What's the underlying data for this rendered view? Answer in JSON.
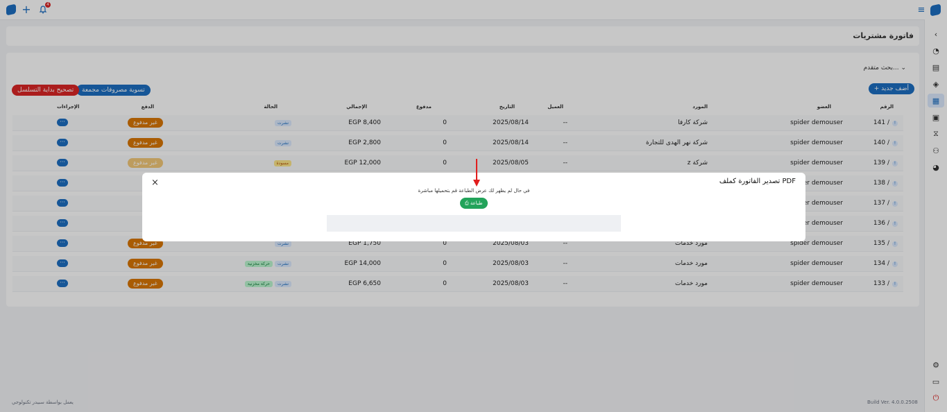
{
  "topbar": {
    "notification_count": "4"
  },
  "page": {
    "title": "فاتورة مشتريات"
  },
  "toolbar": {
    "advanced_search": "بحث متقدم...",
    "add_new": "+ أضف جديد",
    "settle_expenses": "تسوية مصروفات مجمعة",
    "fix_sequence": "تصحيح بداية التسلسل"
  },
  "table": {
    "headers": [
      "الرقم",
      "العضو",
      "المورد",
      "العميل",
      "التاريخ",
      "مدفوع",
      "الإجمالي",
      "الحالة",
      "الدفع",
      "الإجراءات"
    ],
    "rows": [
      {
        "number": "141 /",
        "member": "spider demouser",
        "supplier": "شركة كارفا",
        "client": "--",
        "date": "2025/08/14",
        "paid": "0",
        "total": "EGP 8,400",
        "status": "نشرت",
        "status2": "",
        "payment": "غير مدفوع",
        "action": "···"
      },
      {
        "number": "140 /",
        "member": "spider demouser",
        "supplier": "شركة  نهر الهدى للتجارة",
        "client": "--",
        "date": "2025/08/14",
        "paid": "0",
        "total": "EGP 2,800",
        "status": "نشرت",
        "status2": "",
        "payment": "غير مدفوع",
        "action": "···"
      },
      {
        "number": "139 /",
        "member": "spider demouser",
        "supplier": "شركة z",
        "client": "--",
        "date": "2025/08/05",
        "paid": "0",
        "total": "EGP 12,000",
        "status": "مسودة",
        "status2": "",
        "payment": "غير مدفوع",
        "action": "···"
      },
      {
        "number": "138 /",
        "member": "spider demouser",
        "supplier": "",
        "client": "",
        "date": "",
        "paid": "",
        "total": "",
        "status": "",
        "status2": "",
        "payment": "",
        "action": "···"
      },
      {
        "number": "137 /",
        "member": "spider demouser",
        "supplier": "",
        "client": "",
        "date": "",
        "paid": "",
        "total": "",
        "status": "",
        "status2": "",
        "payment": "",
        "action": "···"
      },
      {
        "number": "136 /",
        "member": "spider demouser",
        "supplier": "",
        "client": "",
        "date": "",
        "paid": "",
        "total": "",
        "status": "",
        "status2": "",
        "payment": "",
        "action": "···"
      },
      {
        "number": "135 /",
        "member": "spider demouser",
        "supplier": "مورد خدمات",
        "client": "--",
        "date": "2025/08/03",
        "paid": "0",
        "total": "EGP 1,750",
        "status": "نشرت",
        "status2": "",
        "payment": "غير مدفوع",
        "action": "···"
      },
      {
        "number": "134 /",
        "member": "spider demouser",
        "supplier": "مورد خدمات",
        "client": "--",
        "date": "2025/08/03",
        "paid": "0",
        "total": "EGP 14,000",
        "status": "نشرت",
        "status2": "حركة مخزنية",
        "payment": "غير مدفوع",
        "action": "···"
      },
      {
        "number": "133 /",
        "member": "spider demouser",
        "supplier": "مورد خدمات",
        "client": "--",
        "date": "2025/08/03",
        "paid": "0",
        "total": "EGP 6,650",
        "status": "نشرت",
        "status2": "حركة مخزنية",
        "payment": "غير مدفوع",
        "action": "···"
      }
    ]
  },
  "footer": {
    "credit": "يعمل بواسطة سبيدر تكنولوجي",
    "build": "Build Ver. 4.0.0.2508"
  },
  "modal": {
    "title": "تصدير الفاتورة كملف PDF",
    "message": "في حال لم يظهر لك عرض الطباعة قم بتحميلها مباشرة",
    "print_label": "⎙ طباعة",
    "close": "×"
  },
  "colors": {
    "primary": "#1d6fc2",
    "danger": "#dc2626",
    "warning": "#d97706",
    "success": "#22a35a"
  },
  "icons": [
    "logo-icon",
    "plus-icon",
    "bell-icon",
    "menu-icon",
    "chevron-left-icon",
    "settings-icon",
    "power-icon"
  ]
}
